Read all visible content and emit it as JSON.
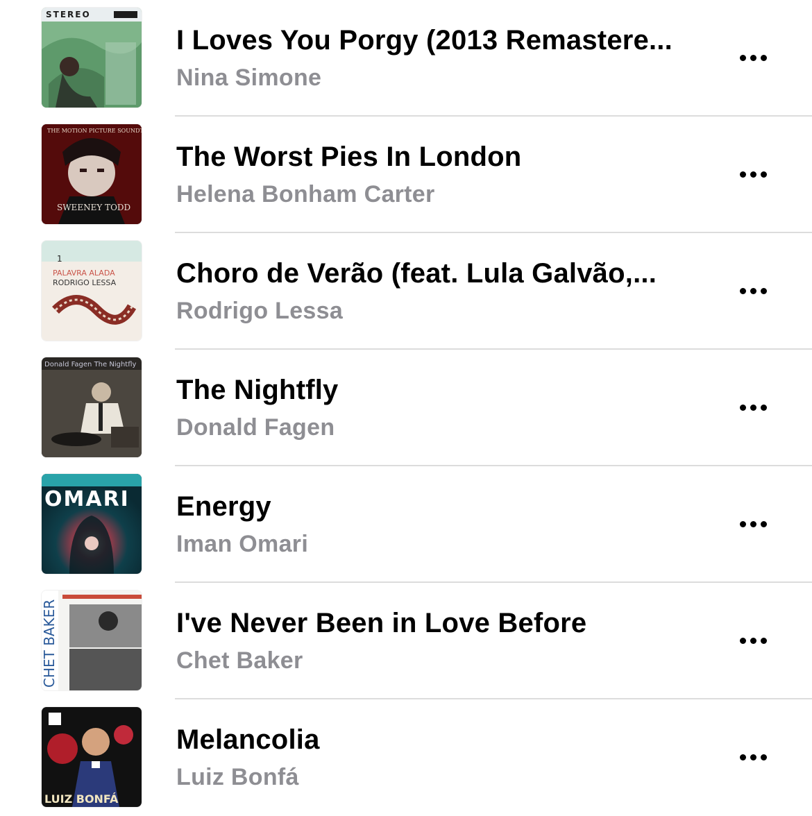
{
  "songs": [
    {
      "title": "I Loves You Porgy (2013 Remastere...",
      "artist": "Nina Simone",
      "artwork_icon": "nina-simone-little-girl-blue-artwork",
      "artwork_text": "STEREO"
    },
    {
      "title": "The Worst Pies In London",
      "artist": "Helena Bonham Carter",
      "artwork_icon": "sweeney-todd-soundtrack-artwork",
      "artwork_text": "THE MOTION PICTURE SOUNDTRACK"
    },
    {
      "title": "Choro de Verão (feat. Lula Galvão,...",
      "artist": "Rodrigo Lessa",
      "artwork_icon": "palavra-alada-artwork",
      "artwork_text": "PALAVRA ALADA"
    },
    {
      "title": "The Nightfly",
      "artist": "Donald Fagen",
      "artwork_icon": "the-nightfly-artwork",
      "artwork_text": "Donald Fagen   The Nightfly"
    },
    {
      "title": "Energy",
      "artist": "Iman Omari",
      "artwork_icon": "iman-omari-artwork",
      "artwork_text": "OMARI"
    },
    {
      "title": "I've Never Been in Love Before",
      "artist": "Chet Baker",
      "artwork_icon": "chet-baker-sings-artwork",
      "artwork_text": "CHET BAKER"
    },
    {
      "title": "Melancolia",
      "artist": "Luiz Bonfá",
      "artwork_icon": "luiz-bonfa-melancolia-artwork",
      "artwork_text": "LUIZ BONFÁ"
    }
  ],
  "more_icon": "ellipsis-icon",
  "colors": {
    "title": "#000000",
    "artist": "#8e8e93",
    "separator": "#dcdcdc",
    "background": "#ffffff"
  }
}
